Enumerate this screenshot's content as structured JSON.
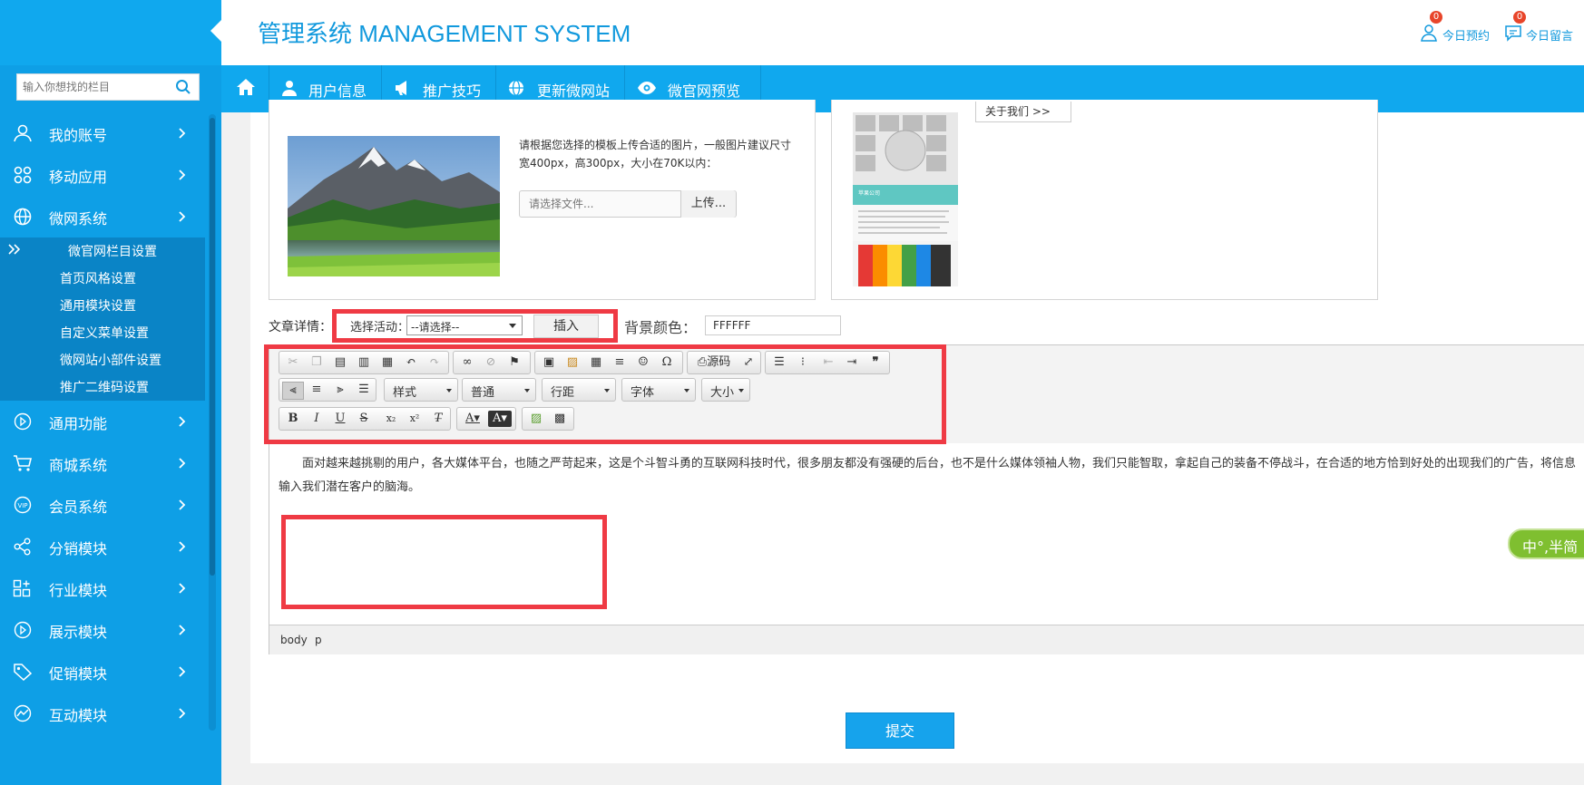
{
  "header": {
    "title": "管理系统 MANAGEMENT SYSTEM",
    "links": [
      {
        "label": "今日预约",
        "badge": "0",
        "icon": "user-icon"
      },
      {
        "label": "今日留言",
        "badge": "0",
        "icon": "message-icon"
      }
    ]
  },
  "sidebar": {
    "search_placeholder": "输入你想找的栏目",
    "items": [
      {
        "label": "我的账号",
        "icon": "user-icon"
      },
      {
        "label": "移动应用",
        "icon": "apps-icon"
      },
      {
        "label": "微网系统",
        "icon": "globe-icon"
      },
      {
        "label": "通用功能",
        "icon": "play-circle-icon"
      },
      {
        "label": "商城系统",
        "icon": "cart-icon"
      },
      {
        "label": "会员系统",
        "icon": "vip-icon"
      },
      {
        "label": "分销模块",
        "icon": "share-icon"
      },
      {
        "label": "行业模块",
        "icon": "grid-plus-icon"
      },
      {
        "label": "展示模块",
        "icon": "play-circle-icon"
      },
      {
        "label": "促销模块",
        "icon": "tag-icon"
      },
      {
        "label": "互动模块",
        "icon": "chart-icon"
      }
    ],
    "submenu": [
      "微官网栏目设置",
      "首页风格设置",
      "通用模块设置",
      "自定义菜单设置",
      "微网站小部件设置",
      "推广二维码设置"
    ]
  },
  "topnav": {
    "items": [
      {
        "label": "用户信息",
        "icon": "user-icon"
      },
      {
        "label": "推广技巧",
        "icon": "megaphone-icon"
      },
      {
        "label": "更新微网站",
        "icon": "globe-icon"
      },
      {
        "label": "微官网预览",
        "icon": "eye-icon"
      }
    ]
  },
  "upload": {
    "hint": "请根据您选择的模板上传合适的图片，一般图片建议尺寸宽400px，高300px，大小在70K以内：",
    "file_placeholder": "请选择文件...",
    "upload_label": "上传..."
  },
  "preview": {
    "button_partial": "关于我们 >>",
    "company": "苹果公司"
  },
  "article": {
    "label": "文章详情：",
    "activity_label": "选择活动：",
    "activity_value": "--请选择--",
    "insert_label": "插入",
    "bgcolor_label": "背景颜色：",
    "bgcolor_value": "FFFFFF"
  },
  "editor": {
    "combos": [
      "样式",
      "普通",
      "行距",
      "字体",
      "大小"
    ],
    "source_label": "源码",
    "content": "面对越来越挑剔的用户，各大媒体平台，也随之严苛起来，这是个斗智斗勇的互联网科技时代，很多朋友都没有强硬的后台，也不是什么媒体领袖人物，我们只能智取，拿起自己的装备不停战斗，在合适的地方恰到好处的出现我们的广告，将信息输入我们潜在客户的脑海。",
    "status_path": [
      "body",
      "p"
    ],
    "ime": "中°,半简"
  },
  "submit_label": "提交",
  "colors": {
    "sidebar": "#0e9fe6",
    "submenu": "#0a84c6",
    "accent": "#1199dd",
    "annotation": "#ef3a44"
  }
}
